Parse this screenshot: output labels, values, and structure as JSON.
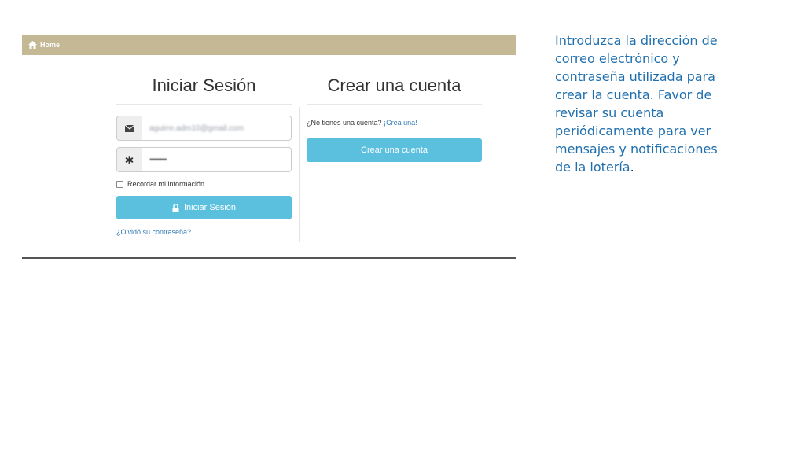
{
  "navbar": {
    "home_label": "Home"
  },
  "login": {
    "title": "Iniciar Sesión",
    "email_value": "aguirre.adm10@gmail.com",
    "password_value": "••••••••••",
    "remember_label": "Recordar mi información",
    "submit_label": "Iniciar Sesión",
    "forgot_label": "¿Olvidó su contraseña?"
  },
  "create": {
    "title": "Crear una cuenta",
    "prompt": "¿No tienes una cuenta?",
    "prompt_link": "¡Crea una!",
    "button_label": "Crear una cuenta"
  },
  "note": {
    "text": "Introduzca la dirección de correo electrónico y contraseña utilizada para crear la cuenta. Favor de revisar su cuenta periódicamente para ver mensajes y notificaciones de la lotería",
    "period": "."
  },
  "colors": {
    "navbar": "#c4b895",
    "button": "#5bc0de",
    "link": "#337ab7",
    "note_text": "#1f6fae"
  },
  "icons": {
    "home": "home-icon",
    "email": "envelope-icon",
    "password": "asterisk-icon",
    "lock": "lock-icon"
  }
}
